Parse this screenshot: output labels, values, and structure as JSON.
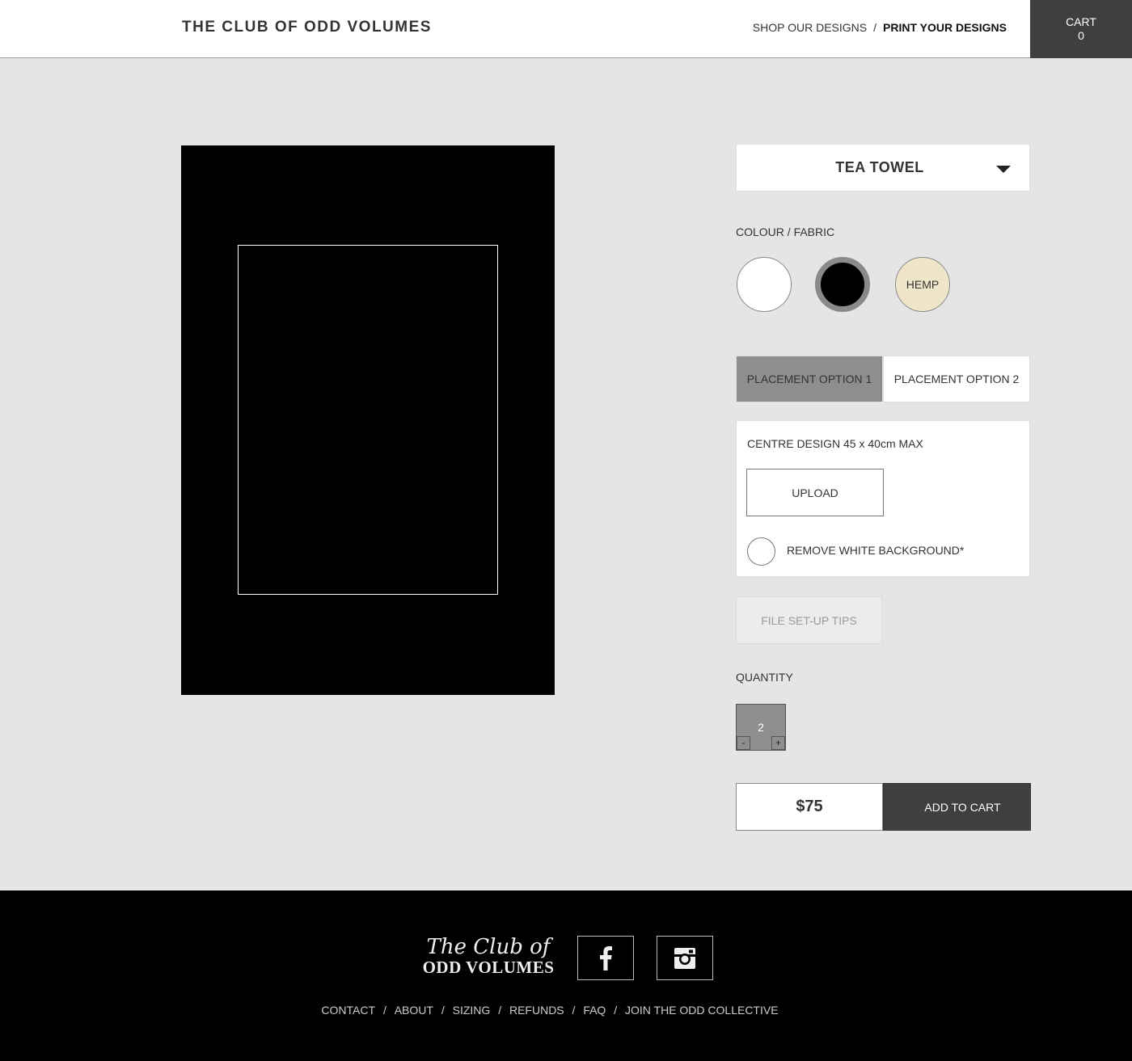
{
  "header": {
    "brand": "THE CLUB OF ODD VOLUMES",
    "nav": [
      {
        "label": "SHOP OUR DESIGNS"
      },
      {
        "label": "PRINT YOUR DESIGNS",
        "active": true
      }
    ],
    "nav_separator": "/",
    "cart": {
      "label": "CART",
      "count": "0"
    }
  },
  "preview": {
    "product_color": "#000000",
    "print_area_border": "#ffffff"
  },
  "product": {
    "selected": "TEA TOWEL",
    "dropdown_icon": "caret-down-icon"
  },
  "colour": {
    "label": "COLOUR / FABRIC",
    "swatches": [
      {
        "name": "white",
        "color": "#ffffff",
        "label": ""
      },
      {
        "name": "black",
        "color": "#000000",
        "label": "",
        "selected": true
      },
      {
        "name": "hemp",
        "color": "#efe6c9",
        "label": "HEMP"
      }
    ]
  },
  "placement": {
    "options": [
      {
        "label": "PLACEMENT OPTION 1",
        "selected": true
      },
      {
        "label": "PLACEMENT OPTION 2"
      }
    ]
  },
  "design": {
    "title": "CENTRE DESIGN 45 x 40cm MAX",
    "upload_label": "UPLOAD",
    "remove_bg_label": "REMOVE WHITE BACKGROUND*"
  },
  "tips": {
    "label": "FILE SET-UP TIPS"
  },
  "quantity": {
    "label": "QUANTITY",
    "value": "2",
    "minus": "-",
    "plus": "+"
  },
  "purchase": {
    "price": "$75",
    "add_to_cart": "ADD TO CART"
  },
  "footer": {
    "logo_script": "The Club of",
    "logo_caps": "ODD VOLUMES",
    "social": [
      {
        "icon": "facebook-icon"
      },
      {
        "icon": "instagram-icon"
      }
    ],
    "links": [
      "CONTACT",
      "ABOUT",
      "SIZING",
      "REFUNDS",
      "FAQ",
      "JOIN THE ODD COLLECTIVE"
    ],
    "separator": "/"
  }
}
